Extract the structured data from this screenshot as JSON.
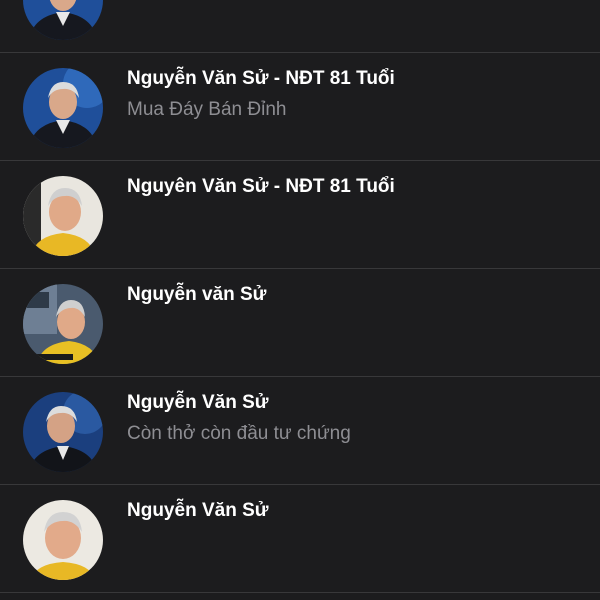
{
  "colors": {
    "background": "#1c1c1e",
    "divider": "#38383a",
    "name_text": "#ffffff",
    "subtitle_text": "#8e8e93"
  },
  "results": [
    {
      "name": "",
      "subtitle": "",
      "avatar": "avatar-blue-suit-icon"
    },
    {
      "name": "Nguyễn Văn Sử - NĐT 81 Tuổi",
      "subtitle": "Mua Đáy Bán Đỉnh",
      "avatar": "avatar-blue-suit-icon"
    },
    {
      "name": "Nguyên Văn Sử - NĐT 81 Tuổi",
      "subtitle": "",
      "avatar": "avatar-yellow-shirt-icon"
    },
    {
      "name": "Nguyễn văn Sử",
      "subtitle": "",
      "avatar": "avatar-yellow-shirt-studio-icon"
    },
    {
      "name": "Nguyễn Văn Sử",
      "subtitle": "Còn thở còn đầu tư chứng",
      "avatar": "avatar-blue-suit-icon"
    },
    {
      "name": "Nguyễn Văn Sử",
      "subtitle": "",
      "avatar": "avatar-yellow-shirt-icon"
    }
  ]
}
